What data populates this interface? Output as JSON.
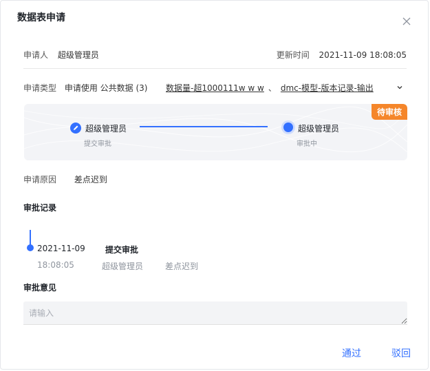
{
  "dialog": {
    "title": "数据表申请"
  },
  "applicant": {
    "label": "申请人",
    "value": "超级管理员"
  },
  "updated": {
    "label": "更新时间",
    "value": "2021-11-09 18:08:05"
  },
  "apply_type": {
    "label": "申请类型",
    "value": "申请使用 公共数据 (3)",
    "tables": [
      "数据量-超1000111w w w",
      "dmc-模型-版本记录-输出"
    ],
    "separator": "、"
  },
  "flow": {
    "status_badge": "待审核",
    "status_color": "#f5862a",
    "accent_color": "#3370ff",
    "steps": [
      {
        "name": "超级管理员",
        "sub": "提交审批",
        "icon": "pencil-icon"
      },
      {
        "name": "超级管理员",
        "sub": "审批中",
        "icon": "active-dot-icon"
      }
    ]
  },
  "reason": {
    "label": "申请原因",
    "value": "差点迟到"
  },
  "records": {
    "title": "审批记录",
    "items": [
      {
        "date": "2021-11-09",
        "time": "18:08:05",
        "action": "提交审批",
        "user": "超级管理员",
        "reason": "差点迟到"
      }
    ]
  },
  "opinion": {
    "title": "审批意见",
    "placeholder": "请输入",
    "value": ""
  },
  "actions": {
    "approve": "通过",
    "reject": "驳回"
  }
}
